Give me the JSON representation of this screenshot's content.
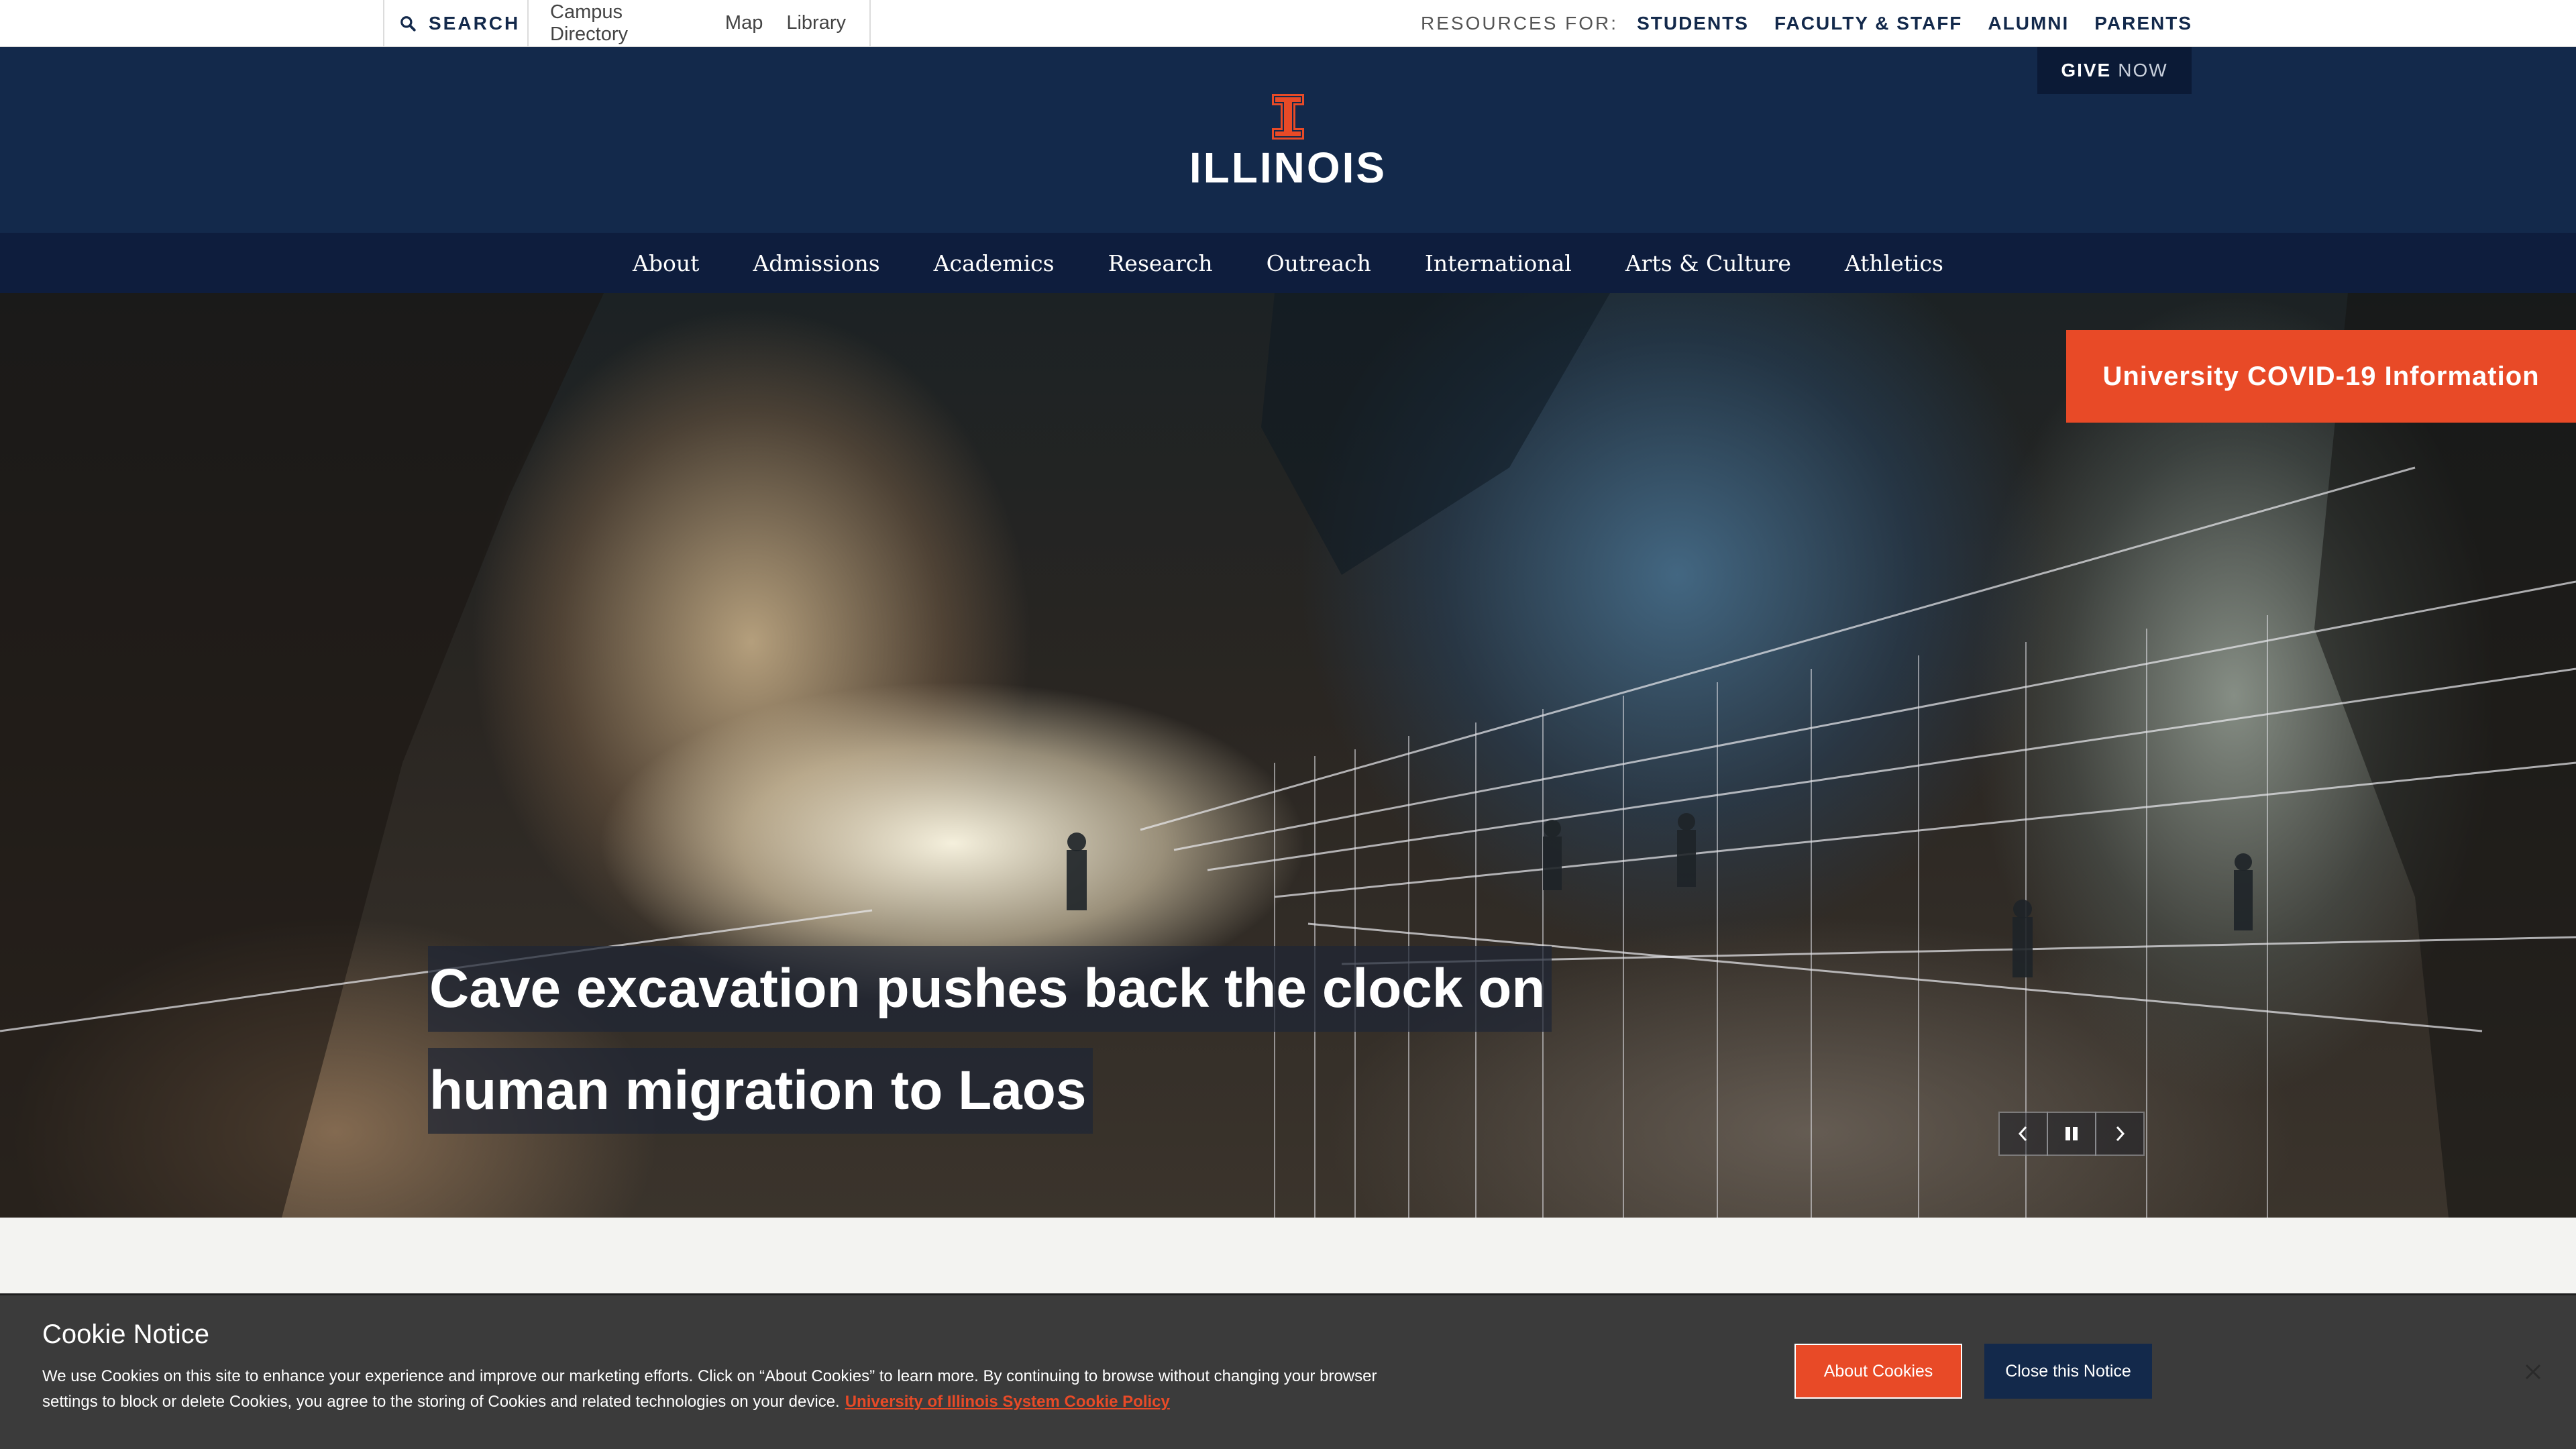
{
  "utility": {
    "search_label": "SEARCH",
    "links": [
      "Campus Directory",
      "Map",
      "Library"
    ],
    "resources_label": "RESOURCES FOR:",
    "resources": [
      "STUDENTS",
      "FACULTY & STAFF",
      "ALUMNI",
      "PARENTS"
    ]
  },
  "header": {
    "give_bold": "GIVE",
    "give_rest": "NOW",
    "wordmark": "ILLINOIS"
  },
  "nav": {
    "items": [
      "About",
      "Admissions",
      "Academics",
      "Research",
      "Outreach",
      "International",
      "Arts & Culture",
      "Athletics"
    ]
  },
  "hero": {
    "covid_label": "University COVID-19 Information",
    "headline_line1": "Cave excavation pushes back the clock on",
    "headline_line2": "human migration to Laos"
  },
  "cookie": {
    "title": "Cookie Notice",
    "text": "We use Cookies on this site to enhance your experience and improve our marketing efforts. Click on “About Cookies” to learn more. By continuing to browse without changing your browser settings to block or delete Cookies, you agree to the storing of Cookies and related technologies on your device.",
    "policy_link": "University of Illinois System Cookie Policy",
    "about_button": "About Cookies",
    "close_button": "Close this Notice"
  },
  "colors": {
    "illinois_blue": "#13294b",
    "illinois_orange": "#e84a27",
    "nav_dark": "#0e1d3d"
  }
}
